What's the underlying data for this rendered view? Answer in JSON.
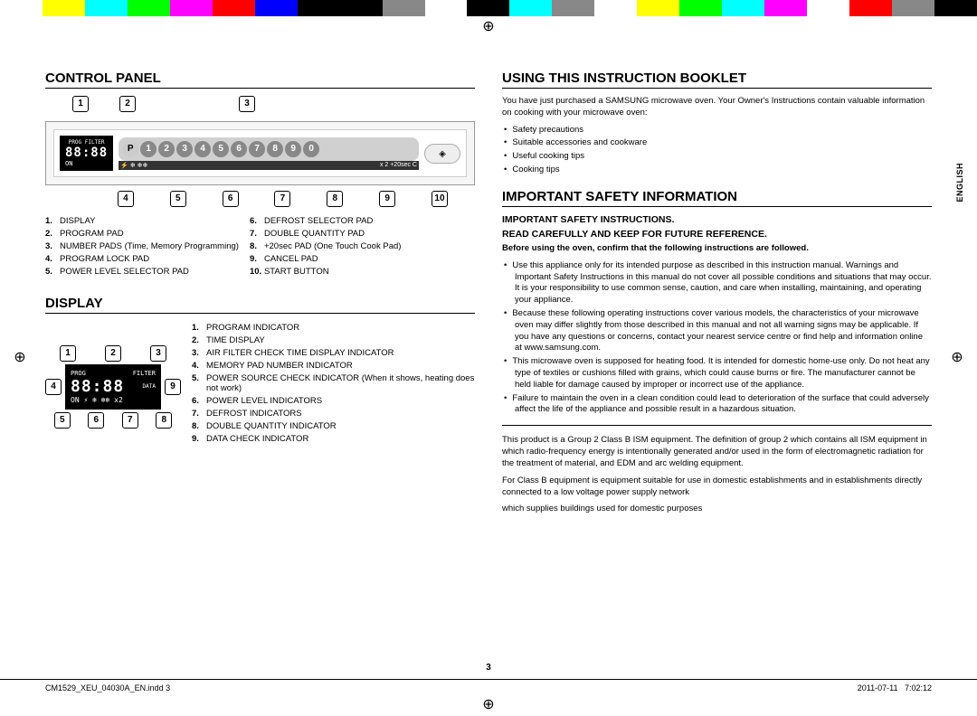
{
  "colorbar": [
    "#fff",
    "#ff0",
    "#0ff",
    "#0f0",
    "#f0f",
    "#f00",
    "#00f",
    "#000",
    "#000",
    "#888",
    "#fff",
    "#000",
    "#0ff",
    "#888",
    "#fff",
    "#ff0",
    "#0f0",
    "#0ff",
    "#f0f",
    "#fff",
    "#f00",
    "#888",
    "#000"
  ],
  "sidebar_lang": "ENGLISH",
  "page_number": "3",
  "footer": {
    "file": "CM1529_XEU_04030A_EN.indd   3",
    "date": "2011-07-11",
    "time": "7:02:12"
  },
  "left": {
    "h_control": "CONTROL PANEL",
    "panel": {
      "lcd_top": "PROG  FILTER",
      "lcd_main": "88:88",
      "lcd_bot": "ON",
      "p_label": "P",
      "numbers": [
        "1",
        "2",
        "3",
        "4",
        "5",
        "6",
        "7",
        "8",
        "9",
        "0"
      ],
      "sec_row_l": "⚡ ❄ ❄❄",
      "sec_row_r": "x 2   +20sec  C",
      "start": "◈",
      "callouts_top": [
        "1",
        "2",
        "3"
      ],
      "callouts_bot": [
        "4",
        "5",
        "6",
        "7",
        "8",
        "9",
        "10"
      ]
    },
    "legend_a": [
      {
        "n": "1.",
        "t": "DISPLAY"
      },
      {
        "n": "2.",
        "t": "PROGRAM PAD"
      },
      {
        "n": "3.",
        "t": "NUMBER PADS (Time, Memory Programming)"
      },
      {
        "n": "4.",
        "t": "PROGRAM LOCK PAD"
      },
      {
        "n": "5.",
        "t": "POWER LEVEL SELECTOR PAD"
      }
    ],
    "legend_b": [
      {
        "n": "6.",
        "t": "DEFROST SELECTOR PAD"
      },
      {
        "n": "7.",
        "t": "DOUBLE QUANTITY PAD"
      },
      {
        "n": "8.",
        "t": "+20sec PAD (One Touch Cook Pad)"
      },
      {
        "n": "9.",
        "t": "CANCEL PAD"
      },
      {
        "n": "10.",
        "t": "START BUTTON"
      }
    ],
    "h_display": "DISPLAY",
    "disp": {
      "top_co": [
        "1",
        "2",
        "3"
      ],
      "left_co": "4",
      "right_co": "9",
      "bot_co": [
        "5",
        "6",
        "7",
        "8"
      ],
      "row1_l": "PROG",
      "row1_r": "FILTER",
      "row2": "88:88",
      "row2_r": "DATA",
      "row3": "ON  ⚡ ❄ ❄❄  x2"
    },
    "disp_legend": [
      {
        "n": "1.",
        "t": "PROGRAM INDICATOR"
      },
      {
        "n": "2.",
        "t": "TIME DISPLAY"
      },
      {
        "n": "3.",
        "t": "AIR FILTER CHECK TIME DISPLAY INDICATOR"
      },
      {
        "n": "4.",
        "t": "MEMORY PAD NUMBER INDICATOR"
      },
      {
        "n": "5.",
        "t": "POWER SOURCE CHECK INDICATOR (When it shows, heating does not work)"
      },
      {
        "n": "6.",
        "t": "POWER LEVEL INDICATORS"
      },
      {
        "n": "7.",
        "t": "DEFROST INDICATORS"
      },
      {
        "n": "8.",
        "t": "DOUBLE QUANTITY INDICATOR"
      },
      {
        "n": "9.",
        "t": "DATA CHECK INDICATOR"
      }
    ]
  },
  "right": {
    "h_using": "USING THIS INSTRUCTION BOOKLET",
    "intro": "You have just purchased a SAMSUNG microwave oven. Your Owner's Instructions contain valuable information on cooking with your microwave oven:",
    "intro_list": [
      "Safety precautions",
      "Suitable accessories and cookware",
      "Useful cooking tips",
      "Cooking tips"
    ],
    "h_safety": "IMPORTANT SAFETY INFORMATION",
    "sub1": "IMPORTANT SAFETY INSTRUCTIONS.",
    "sub2": "READ CAREFULLY AND KEEP FOR FUTURE REFERENCE.",
    "sub3": "Before using the oven, confirm that the following instructions are followed.",
    "bullets": [
      "Use this appliance only for its intended purpose as described in this instruction manual. Warnings and Important Safety Instructions in this manual do not cover all possible conditions and situations that may occur. It is your responsibility to use common sense, caution, and care when installing, maintaining, and operating your appliance.",
      "Because these following operating instructions cover various models, the characteristics of your microwave oven may differ slightly from those described in this manual and not all warning signs may be applicable. If you have any questions or concerns, contact your nearest service centre or find help and information online at www.samsung.com.",
      "This microwave oven is supposed for heating food. It is intended for domestic home-use only. Do not heat any type of textiles or cushions filled with grains, which could cause burns or fire. The manufacturer cannot be held liable for damage caused by improper or incorrect use of the appliance.",
      "Failure to maintain the oven in a clean condition could lead to deterioration of the surface that could adversely affect the life of the appliance and possible result in a hazardous situation."
    ],
    "para1": "This product is a Group 2 Class B ISM equipment. The definition of group 2 which contains all ISM equipment in which radio-frequency energy is intentionally generated and/or used in the form of electromagnetic radiation for the treatment of material, and EDM and arc welding equipment.",
    "para2": "For Class B equipment is equipment suitable for use in domestic establishments and in establishments directly connected to a low voltage power supply network",
    "para3": "which supplies buildings used for domestic purposes"
  }
}
